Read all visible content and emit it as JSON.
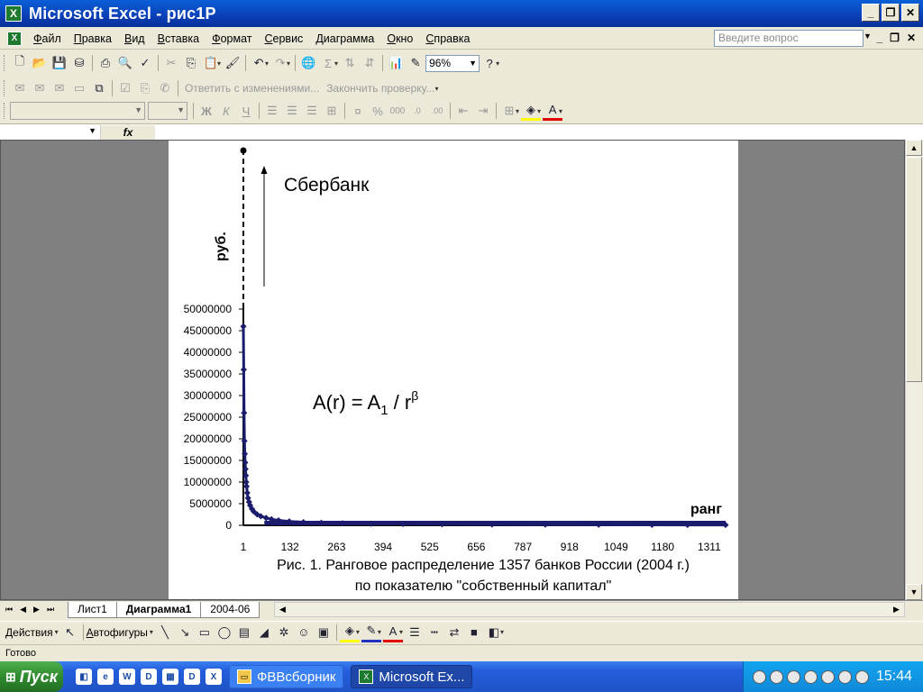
{
  "window": {
    "title": "Microsoft Excel - рис1P",
    "app_icon": "X"
  },
  "menu": {
    "items": [
      "Файл",
      "Правка",
      "Вид",
      "Вставка",
      "Формат",
      "Сервис",
      "Диаграмма",
      "Окно",
      "Справка"
    ],
    "help_placeholder": "Введите вопрос"
  },
  "toolbar": {
    "zoom": "96%"
  },
  "review": {
    "reply_label": "Ответить с изменениями...",
    "end_label": "Закончить проверку..."
  },
  "formula": {
    "fx_label": "fx"
  },
  "chart_data": {
    "type": "scatter",
    "annotation": "Сбербанк",
    "formula": {
      "base": "A(r) = A",
      "sub": "1",
      "mid": " / r",
      "sup": "β"
    },
    "ylabel": "руб.",
    "xlabel": "ранг",
    "yticks": [
      "50000000",
      "45000000",
      "40000000",
      "35000000",
      "30000000",
      "25000000",
      "20000000",
      "15000000",
      "10000000",
      "5000000",
      "0"
    ],
    "yvalues": [
      50000000,
      45000000,
      40000000,
      35000000,
      30000000,
      25000000,
      20000000,
      15000000,
      10000000,
      5000000,
      0
    ],
    "xticks": [
      "1",
      "132",
      "263",
      "394",
      "525",
      "656",
      "787",
      "918",
      "1049",
      "1180",
      "1311"
    ],
    "xvalues": [
      1,
      132,
      263,
      394,
      525,
      656,
      787,
      918,
      1049,
      1180,
      1311
    ],
    "xlim": [
      1,
      1357
    ],
    "ylim": [
      0,
      50000000
    ],
    "series_color": "#1c1c6e",
    "points": [
      [
        1,
        46000000
      ],
      [
        2,
        36000000
      ],
      [
        3,
        26000000
      ],
      [
        4,
        19500000
      ],
      [
        5,
        16500000
      ],
      [
        6,
        14500000
      ],
      [
        7,
        13000000
      ],
      [
        8,
        11500000
      ],
      [
        9,
        10000000
      ],
      [
        10,
        9000000
      ],
      [
        12,
        7500000
      ],
      [
        14,
        6300000
      ],
      [
        17,
        5400000
      ],
      [
        20,
        4600000
      ],
      [
        25,
        3800000
      ],
      [
        30,
        3200000
      ],
      [
        40,
        2500000
      ],
      [
        50,
        2100000
      ],
      [
        65,
        1700000
      ],
      [
        80,
        1400000
      ],
      [
        100,
        1150000
      ],
      [
        130,
        900000
      ],
      [
        170,
        720000
      ],
      [
        220,
        580000
      ],
      [
        280,
        470000
      ],
      [
        360,
        380000
      ],
      [
        450,
        310000
      ],
      [
        560,
        250000
      ],
      [
        700,
        200000
      ],
      [
        850,
        160000
      ],
      [
        1000,
        130000
      ],
      [
        1150,
        105000
      ],
      [
        1250,
        90000
      ],
      [
        1357,
        75000
      ]
    ],
    "caption_line1": "Рис. 1. Ранговое распределение 1357 банков России (2004 г.)",
    "caption_line2": "по показателю \"собственный капитал\""
  },
  "sheets": {
    "tabs": [
      "Лист1",
      "Диаграмма1",
      "2004-06"
    ],
    "active": "Диаграмма1"
  },
  "draw": {
    "actions_label": "Действия",
    "autoshapes_label": "Автофигуры"
  },
  "status": {
    "text": "Готово"
  },
  "taskbar": {
    "start_label": "Пуск",
    "tasks": [
      {
        "label": "ФВВсборник",
        "active": false
      },
      {
        "label": "Microsoft Ex...",
        "active": true
      }
    ],
    "clock": "15:44"
  },
  "colors": {
    "titlebar": "#0a3fb6",
    "taskbar": "#245edb",
    "start": "#2e8b2e"
  }
}
